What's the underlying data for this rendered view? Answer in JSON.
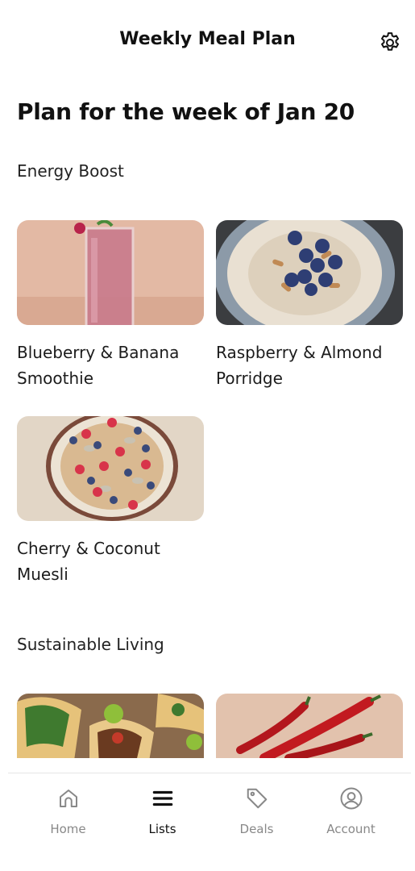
{
  "header": {
    "title": "Weekly Meal Plan",
    "settings_icon": "gear-icon"
  },
  "week_title": "Plan for the week of Jan 20",
  "sections": [
    {
      "title": "Energy Boost",
      "recipes": [
        {
          "name": "Blueberry & Banana Smoothie"
        },
        {
          "name": "Raspberry & Almond Porridge"
        },
        {
          "name": "Cherry & Coconut Muesli"
        }
      ]
    },
    {
      "title": "Sustainable Living",
      "recipes": []
    }
  ],
  "nav": {
    "active": "Lists",
    "items": [
      {
        "label": "Home",
        "icon": "home-icon"
      },
      {
        "label": "Lists",
        "icon": "menu-lines-icon"
      },
      {
        "label": "Deals",
        "icon": "tag-icon"
      },
      {
        "label": "Account",
        "icon": "account-circle-icon"
      }
    ]
  },
  "colors": {
    "active": "#111111",
    "inactive": "#888888",
    "divider": "#e6e6e6"
  }
}
